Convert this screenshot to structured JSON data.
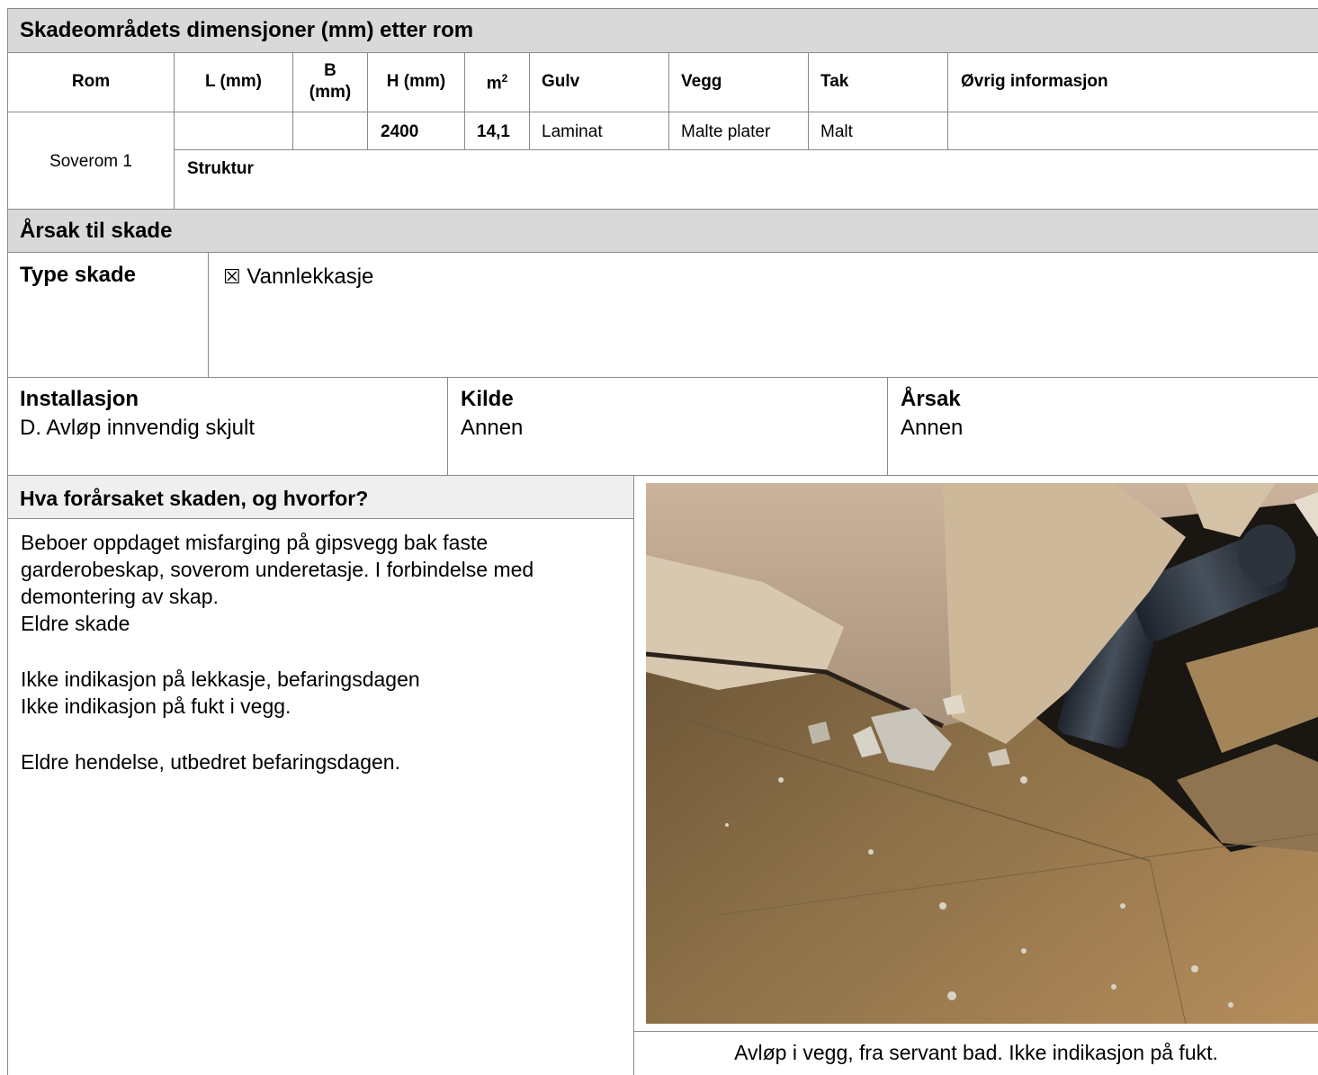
{
  "dimensions_section": {
    "title": "Skadeområdets dimensjoner (mm) etter rom",
    "headers": {
      "rom": "Rom",
      "l": "L (mm)",
      "b_top": "B",
      "b_bottom": "(mm)",
      "h": "H (mm)",
      "m2_base": "m",
      "m2_sup": "2",
      "gulv": "Gulv",
      "vegg": "Vegg",
      "tak": "Tak",
      "ovrig": "Øvrig informasjon"
    },
    "row": {
      "rom": "Soverom 1",
      "l": "",
      "b": "",
      "h": "2400",
      "m2": "14,1",
      "gulv": "Laminat",
      "vegg": "Malte plater",
      "tak": "Malt",
      "ovrig": ""
    },
    "struktur_label": "Struktur"
  },
  "cause_section": {
    "title": "Årsak til skade",
    "type_label": "Type skade",
    "checkbox_glyph": "☒",
    "type_value": "Vannlekkasje",
    "installasjon_label": "Installasjon",
    "installasjon_value": "D. Avløp innvendig skjult",
    "kilde_label": "Kilde",
    "kilde_value": "Annen",
    "arsak_label": "Årsak",
    "arsak_value": "Annen"
  },
  "description_section": {
    "title": "Hva forårsaket skaden, og hvorfor?",
    "lines": [
      "Beboer oppdaget misfarging på gipsvegg bak faste",
      "garderobeskap, soverom underetasje. I forbindelse med",
      "demontering av skap.",
      "Eldre skade",
      "Ikke indikasjon på lekkasje, befaringsdagen",
      "Ikke indikasjon på fukt i vegg.",
      "Eldre hendelse, utbedret befaringsdagen."
    ],
    "photo_caption": "Avløp i vegg, fra servant bad. Ikke indikasjon på fukt."
  }
}
